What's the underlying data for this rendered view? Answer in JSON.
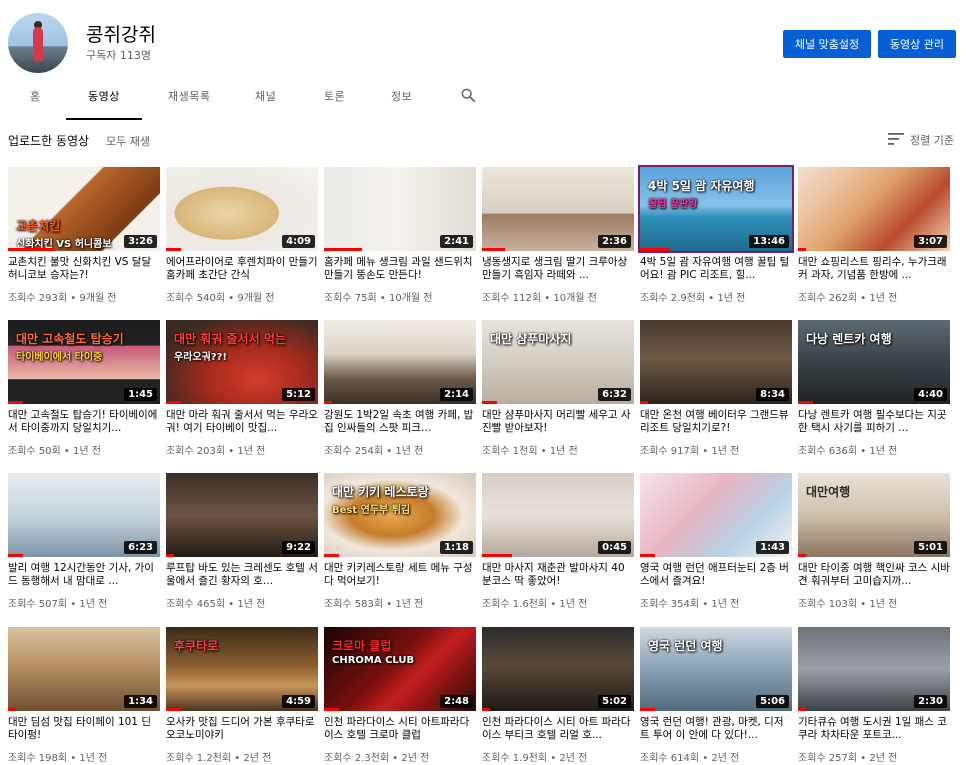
{
  "channel": {
    "name": "콩쥐강쥐",
    "subscribers": "구독자 113명",
    "customize_label": "채널 맞춤설정",
    "manage_label": "동영상 관리"
  },
  "tabs": [
    {
      "label": "홈"
    },
    {
      "label": "동영상"
    },
    {
      "label": "재생목록"
    },
    {
      "label": "채널"
    },
    {
      "label": "토론"
    },
    {
      "label": "정보"
    }
  ],
  "section": {
    "title": "업로드한 동영상",
    "play_all": "모두 재생",
    "sort_label": "정렬 기준"
  },
  "colors": {
    "accent": "#065fd4",
    "progress": "#ff0000"
  },
  "videos": [
    {
      "title": "교촌치킨 불맛 신화치킨 VS 달달 허니코보 승자는?!",
      "views": "조회수 293회",
      "age": "9개월 전",
      "duration": "3:26",
      "overlay": [
        "교촌치킨",
        "신화치킨 VS 허니콤보"
      ],
      "progress": 0.3
    },
    {
      "title": "에어프라이어로 후렌치파이 만들기 홈카페 초간단 간식",
      "views": "조회수 540회",
      "age": "9개월 전",
      "duration": "4:09",
      "overlay": [],
      "progress": 0.1
    },
    {
      "title": "홈카페 메뉴 생크림 과일 샌드위치 만들기 뚱손도 만든다!",
      "views": "조회수 75회",
      "age": "10개월 전",
      "duration": "2:41",
      "overlay": [],
      "progress": 0.25
    },
    {
      "title": "냉동생지로 생크림 딸기 크루아상 만들기 흑임자 라떼와 ...",
      "views": "조회수 112회",
      "age": "10개월 전",
      "duration": "2:36",
      "overlay": [],
      "progress": 0.15
    },
    {
      "title": "4박 5일 괌 자유여행 여행 꿀팁 털어요! 괌 PIC 리조트, 힐...",
      "views": "조회수 2.9천회",
      "age": "1년 전",
      "duration": "13:46",
      "overlay": [
        "4박 5일 괌 자유여행",
        "꿀팁 끝판왕"
      ],
      "progress": 0.2
    },
    {
      "title": "대만 쇼핑리스트 핑리수, 누가크래커 과자, 기념품 한방에 ...",
      "views": "조회수 262회",
      "age": "1년 전",
      "duration": "3:07",
      "overlay": [],
      "progress": 0.05
    },
    {
      "title": "대만 고속철도 탑승기! 타이베이에서 타이중까지 당일치기...",
      "views": "조회수 50회",
      "age": "1년 전",
      "duration": "1:45",
      "overlay": [
        "대만 고속철도 탑승기",
        "타이베이에서 타이중"
      ],
      "progress": 0.1
    },
    {
      "title": "대만 마라 훠궈 줄서서 먹는 우라오궈! 여기 타이베이 맛집...",
      "views": "조회수 203회",
      "age": "1년 전",
      "duration": "5:12",
      "overlay": [
        "대만 훠궈 줄서서 먹는",
        "우라오궈??!"
      ],
      "progress": 0.1
    },
    {
      "title": "강원도 1박2일 속초 여행 카페, 밥집 인싸들의 스팟 피크...",
      "views": "조회수 254회",
      "age": "1년 전",
      "duration": "2:14",
      "overlay": [],
      "progress": 0.05
    },
    {
      "title": "대만 샴푸마사지 머리빨 세우고 사진빨 받아보자!",
      "views": "조회수 1천회",
      "age": "1년 전",
      "duration": "6:32",
      "overlay": [
        "대만 샴푸마사지"
      ],
      "progress": 0.1
    },
    {
      "title": "대만 온천 여행 베이터우 그랜드뷰 리조트 당일치기로?!",
      "views": "조회수 917회",
      "age": "1년 전",
      "duration": "8:34",
      "overlay": [],
      "progress": 0.05
    },
    {
      "title": "다낭 렌트카 여행 필수보다는 지곳한 택시 사기를 피하기 ...",
      "views": "조회수 636회",
      "age": "1년 전",
      "duration": "4:40",
      "overlay": [
        "다낭 렌트카 여행"
      ],
      "progress": 0.1
    },
    {
      "title": "발리 여행 12시간동안 기사, 가이드 동행해서 내 맘대로 ...",
      "views": "조회수 507회",
      "age": "1년 전",
      "duration": "6:23",
      "overlay": [],
      "progress": 0.1
    },
    {
      "title": "루프탑 바도 있는 크레센도 호텔 서울에서 즐긴 황자의 호...",
      "views": "조회수 465회",
      "age": "1년 전",
      "duration": "9:22",
      "overlay": [],
      "progress": 0.05
    },
    {
      "title": "대만 키키레스토랑 세트 메뉴 구성 다 먹어보기!",
      "views": "조회수 583회",
      "age": "1년 전",
      "duration": "1:18",
      "overlay": [
        "대만 키키 레스토랑",
        "Best 연두부 튀김"
      ],
      "progress": 0.1
    },
    {
      "title": "대만 마사지 재춘관 발마사지 40분코스 딱 좋았어!",
      "views": "조회수 1.6천회",
      "age": "1년 전",
      "duration": "0:45",
      "overlay": [],
      "progress": 0.2
    },
    {
      "title": "영국 여행 런던 애프터눈티 2층 버스에서 즐겨요!",
      "views": "조회수 354회",
      "age": "1년 전",
      "duration": "1:43",
      "overlay": [],
      "progress": 0.1
    },
    {
      "title": "대만 타이중 여행 핵인싸 코스 시바견 훠궈부터 고미습지까...",
      "views": "조회수 103회",
      "age": "1년 전",
      "duration": "5:01",
      "overlay": [
        "대만여행"
      ],
      "progress": 0.05
    },
    {
      "title": "대만 딤섬 맛집 타이페이 101 딘타이펑!",
      "views": "조회수 198회",
      "age": "1년 전",
      "duration": "1:34",
      "overlay": [],
      "progress": 0.05
    },
    {
      "title": "오사카 맛집 드디어 가본 후쿠타로 오코노미야키",
      "views": "조회수 1.2천회",
      "age": "2년 전",
      "duration": "4:59",
      "overlay": [
        "후쿠타로"
      ],
      "progress": 0.1
    },
    {
      "title": "인천 파라다이스 시티 아트파라다이스 호텔 크로마 클럽",
      "views": "조회수 2.3천회",
      "age": "2년 전",
      "duration": "2:48",
      "overlay": [
        "크로마 클럽",
        "CHROMA CLUB"
      ],
      "progress": 0.1
    },
    {
      "title": "인천 파라다이스 시티 아트 파라다이스 부티크 호텔 리얼 호...",
      "views": "조회수 1.9천회",
      "age": "2년 전",
      "duration": "5:02",
      "overlay": [],
      "progress": 0.05
    },
    {
      "title": "영국 런던 여행! 관광, 마켓, 디저트 투어 이 안에 다 있다!...",
      "views": "조회수 614회",
      "age": "2년 전",
      "duration": "5:06",
      "overlay": [
        "영국 런던 여행"
      ],
      "progress": 0.1
    },
    {
      "title": "기타큐슈 여행 도시권 1일 패스 코쿠라 차차타운 포트코...",
      "views": "조회수 257회",
      "age": "2년 전",
      "duration": "2:30",
      "overlay": [],
      "progress": 0.05
    }
  ]
}
